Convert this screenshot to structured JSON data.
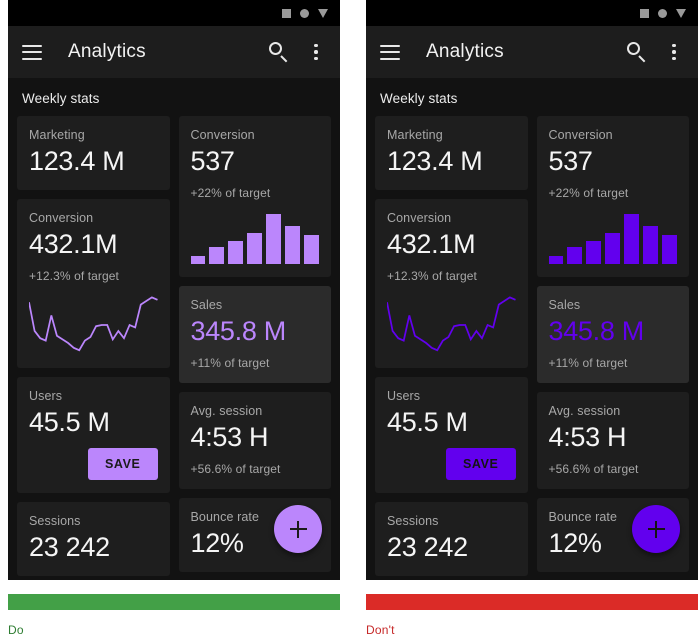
{
  "accents": {
    "do": "#BB86FC",
    "do_on_accent": "#1b1b1b",
    "dont": "#6200EE",
    "dont_on_accent": "#141414",
    "do_rule": "#43A047",
    "dont_rule": "#DB2B27",
    "surface": "#121212",
    "card": "#1e1e1e",
    "card_elevated": "#2b2b2b"
  },
  "statusbar": {
    "icons": [
      "square-icon",
      "circle-icon",
      "triangle-icon"
    ]
  },
  "appbar": {
    "menu_icon": "hamburger-menu-icon",
    "title": "Analytics",
    "search_icon": "search-icon",
    "more_icon": "overflow-menu-icon"
  },
  "section": {
    "title": "Weekly stats"
  },
  "fab": {
    "icon": "plus-icon"
  },
  "save": {
    "label": "SAVE"
  },
  "cards": {
    "marketing": {
      "label": "Marketing",
      "value": "123.4 M"
    },
    "conversion_l": {
      "label": "Conversion",
      "value": "432.1M",
      "sub": "+12.3% of target"
    },
    "users": {
      "label": "Users",
      "value": "45.5 M"
    },
    "sessions": {
      "label": "Sessions",
      "value": "23 242"
    },
    "conversion_r": {
      "label": "Conversion",
      "value": "537",
      "sub": "+22% of target"
    },
    "sales": {
      "label": "Sales",
      "value": "345.8 M",
      "sub": "+11% of target"
    },
    "avg_session": {
      "label": "Avg. session",
      "value": "4:53 H",
      "sub": "+56.6% of target"
    },
    "bounce": {
      "label": "Bounce rate",
      "value": "12%"
    }
  },
  "chart_data": [
    {
      "type": "bar",
      "title": "Conversion weekly bars",
      "categories": [
        "1",
        "2",
        "3",
        "4",
        "5",
        "6",
        "7"
      ],
      "values": [
        8,
        17,
        23,
        31,
        50,
        38,
        29
      ],
      "ylim": [
        0,
        52
      ],
      "xlabel": "",
      "ylabel": "",
      "grid": false,
      "legend": "none"
    },
    {
      "type": "line",
      "title": "Conversion trend sparkline",
      "x": [
        0,
        1,
        2,
        3,
        4,
        5,
        6,
        7,
        8,
        9,
        10,
        11,
        12,
        13,
        14,
        15,
        16,
        17,
        18,
        19,
        20,
        21,
        22,
        23
      ],
      "y": [
        44,
        20,
        14,
        12,
        33,
        16,
        13,
        10,
        6,
        4,
        12,
        15,
        24,
        25,
        25,
        13,
        20,
        14,
        25,
        23,
        42,
        45,
        48,
        46
      ],
      "ylim": [
        0,
        50
      ],
      "xlabel": "",
      "ylabel": "",
      "grid": false,
      "legend": "none"
    }
  ],
  "captions": {
    "do": "Do",
    "dont": "Don't"
  }
}
